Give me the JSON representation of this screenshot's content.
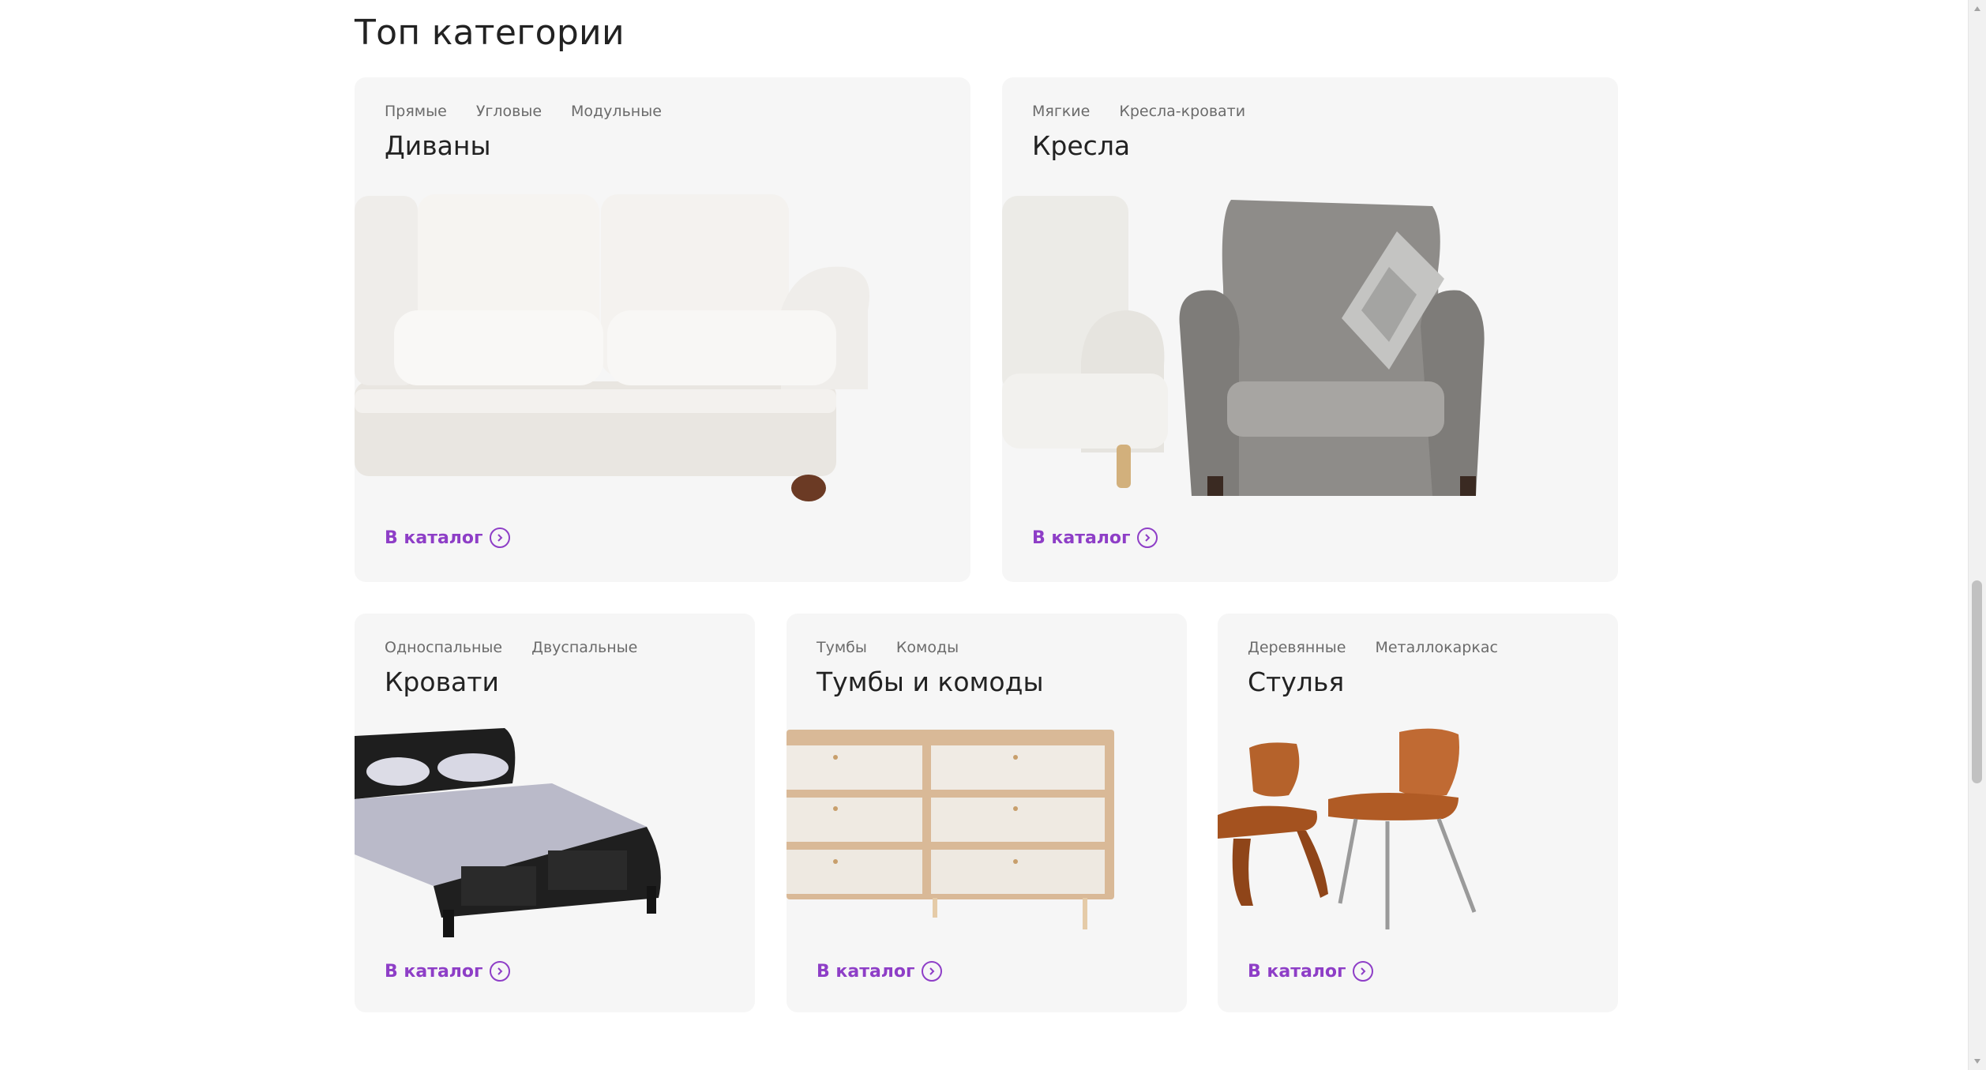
{
  "section": {
    "title": "Топ категории"
  },
  "cards": {
    "sofas": {
      "tags": [
        "Прямые",
        "Угловые",
        "Модульные"
      ],
      "title": "Диваны",
      "link": "В каталог"
    },
    "armchairs": {
      "tags": [
        "Мягкие",
        "Кресла-кровати"
      ],
      "title": "Кресла",
      "link": "В каталог"
    },
    "beds": {
      "tags": [
        "Односпальные",
        "Двуспальные"
      ],
      "title": "Кровати",
      "link": "В каталог"
    },
    "dressers": {
      "tags": [
        "Тумбы",
        "Комоды"
      ],
      "title": "Тумбы и комоды",
      "link": "В каталог"
    },
    "chairs": {
      "tags": [
        "Деревянные",
        "Металлокаркас"
      ],
      "title": "Стулья",
      "link": "В каталог"
    }
  },
  "colors": {
    "accent": "#8e3ec7",
    "card_bg": "#f6f6f6",
    "tag": "#6b6b6b"
  },
  "icons": {
    "catalog_arrow": "chevron-right-circle-icon"
  }
}
